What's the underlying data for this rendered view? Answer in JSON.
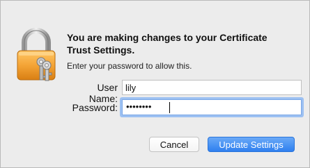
{
  "dialog": {
    "title": "You are making changes to your Certificate Trust Settings.",
    "subtitle": "Enter your password to allow this.",
    "icon": "lock-with-keys-icon"
  },
  "form": {
    "username_label": "User Name:",
    "username_value": "lily",
    "password_label": "Password:",
    "password_masked": "••••••••"
  },
  "buttons": {
    "cancel_label": "Cancel",
    "update_label": "Update Settings"
  },
  "colors": {
    "accent": "#2f80ef",
    "focus_ring": "#9dc1f2",
    "lock_gold": "#f2a23a"
  }
}
